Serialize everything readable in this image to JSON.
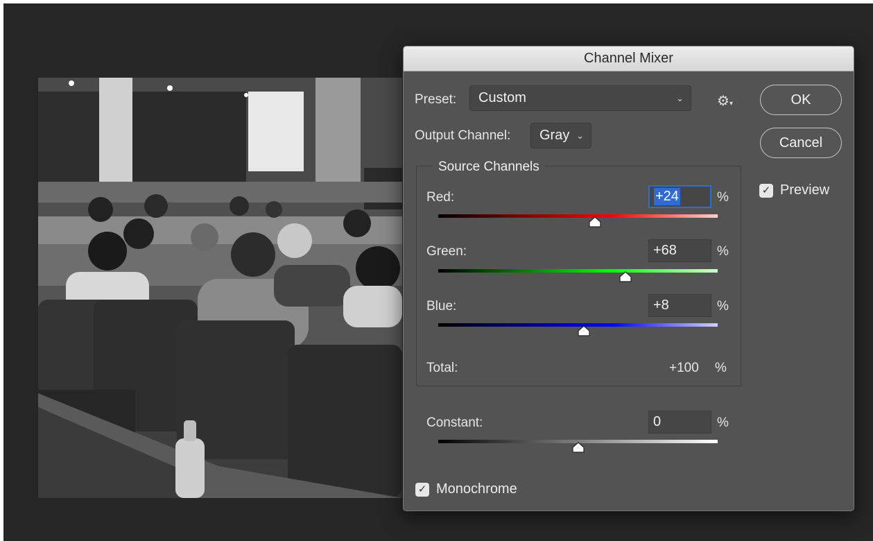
{
  "dialog": {
    "title": "Channel Mixer",
    "preset_label": "Preset:",
    "preset_value": "Custom",
    "output_label": "Output Channel:",
    "output_value": "Gray",
    "ok_label": "OK",
    "cancel_label": "Cancel",
    "preview_label": "Preview",
    "preview_checked": true,
    "source_title": "Source Channels",
    "channels": [
      {
        "label": "Red:",
        "value": "+24",
        "percent": 24,
        "color_end": "#ff0000",
        "light_end": "#ffd0d0"
      },
      {
        "label": "Green:",
        "value": "+68",
        "percent": 68,
        "color_end": "#00ff00",
        "light_end": "#d0ffd0"
      },
      {
        "label": "Blue:",
        "value": "+8",
        "percent": 8,
        "color_end": "#0000ff",
        "light_end": "#d0d0ff"
      }
    ],
    "pct_symbol": "%",
    "total_label": "Total:",
    "total_value": "+100",
    "constant_label": "Constant:",
    "constant_value": "0",
    "constant_percent": 0,
    "monochrome_label": "Monochrome",
    "monochrome_checked": true
  },
  "colors": {
    "dialog_bg": "#535353",
    "focus": "#2f6bd1"
  }
}
